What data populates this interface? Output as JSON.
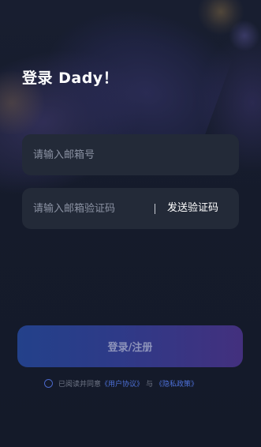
{
  "title": "登录 Dady！",
  "email_field": {
    "placeholder": "请输入邮箱号"
  },
  "code_field": {
    "placeholder": "请输入邮箱验证码",
    "send_code_label": "发送验证码"
  },
  "login_button": {
    "label": "登录/注册"
  },
  "agreement": {
    "prefix": "已阅读并同意",
    "user_agreement": "《用户协议》",
    "conjunction": "与",
    "privacy_policy": "《隐私政策》"
  },
  "colors": {
    "background": "#141a2a",
    "field_background": "#232a38",
    "button_gradient_start": "#23418a",
    "button_gradient_end": "#43307e",
    "link": "#4d70d8"
  }
}
